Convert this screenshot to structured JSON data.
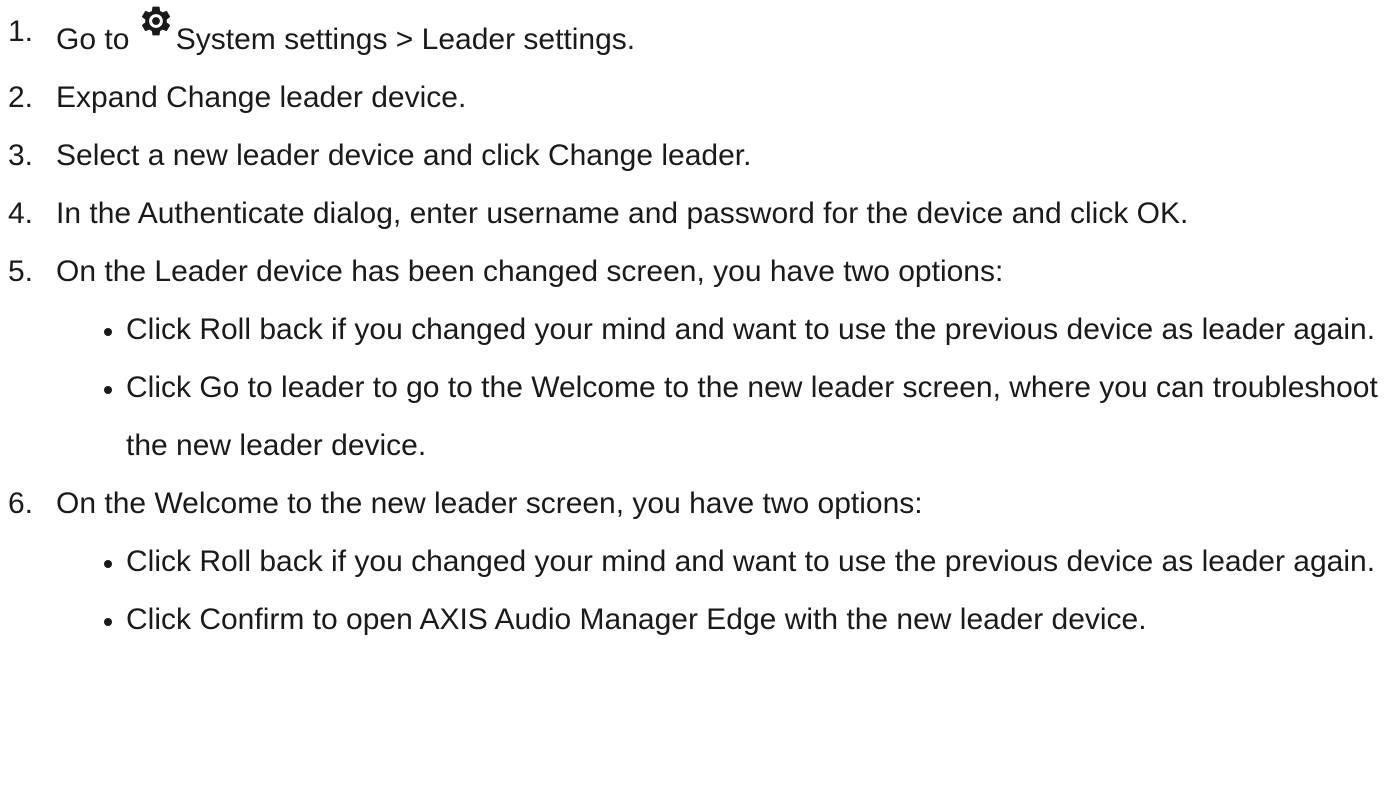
{
  "steps": [
    {
      "number": "1.",
      "before": "Go to ",
      "icon": "gear-icon",
      "text": "System settings > Leader settings."
    },
    {
      "number": "2.",
      "text": "Expand Change leader device."
    },
    {
      "number": "3.",
      "text": "Select a new leader device and click Change leader."
    },
    {
      "number": "4.",
      "text": "In the Authenticate dialog, enter username and password for the device and click OK."
    },
    {
      "number": "5.",
      "text": "On the Leader device has been changed screen, you have two options:",
      "bullets": [
        "Click Roll back if you changed your mind and want to use the previous device as leader again.",
        "Click Go to leader to go to the Welcome to the new leader screen, where you can troubleshoot the new leader device."
      ]
    },
    {
      "number": "6.",
      "text": "On the Welcome to the new leader screen, you have two options:",
      "bullets": [
        "Click Roll back if you changed your mind and want to use the previous device as leader again.",
        "Click Confirm to open AXIS Audio Manager Edge with the new leader device."
      ]
    }
  ]
}
